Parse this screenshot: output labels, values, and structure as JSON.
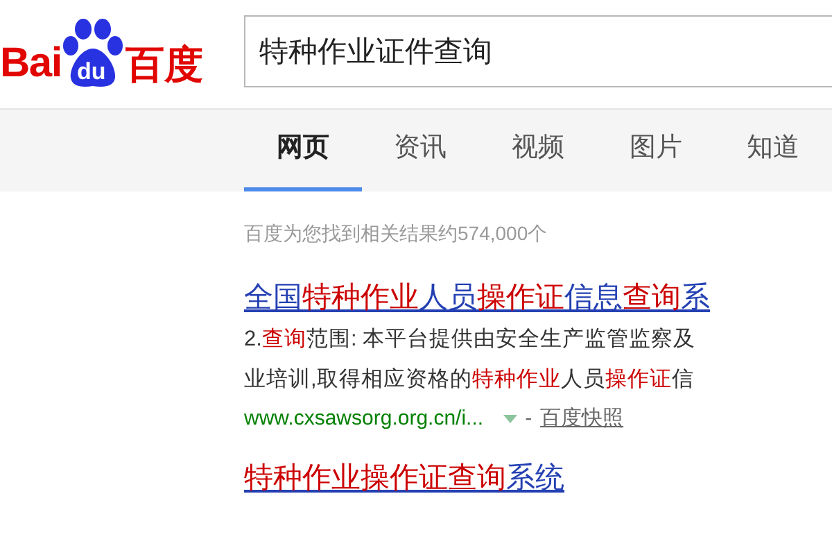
{
  "logo": {
    "parts": [
      "Bai",
      "du",
      "百度"
    ]
  },
  "search": {
    "value": "特种作业证件查询"
  },
  "tabs": [
    {
      "label": "网页",
      "selected": true
    },
    {
      "label": "资讯",
      "selected": false
    },
    {
      "label": "视频",
      "selected": false
    },
    {
      "label": "图片",
      "selected": false
    },
    {
      "label": "知道",
      "selected": false
    }
  ],
  "result_count": "百度为您找到相关结果约574,000个",
  "results": [
    {
      "title": [
        {
          "text": "全国",
          "highlight": false
        },
        {
          "text": "特种作业",
          "highlight": true
        },
        {
          "text": "人员",
          "highlight": false
        },
        {
          "text": "操作证",
          "highlight": true
        },
        {
          "text": "信息",
          "highlight": false
        },
        {
          "text": "查询",
          "highlight": true
        },
        {
          "text": "系",
          "highlight": false
        }
      ],
      "snippet": [
        [
          {
            "text": "2.",
            "highlight": false
          },
          {
            "text": "查询",
            "highlight": true
          },
          {
            "text": "范围: 本平台提供由安全生产监管监察及",
            "highlight": false
          }
        ],
        [
          {
            "text": "业培训,取得相应资格的",
            "highlight": false
          },
          {
            "text": "特种作业",
            "highlight": true
          },
          {
            "text": "人员",
            "highlight": false
          },
          {
            "text": "操作证",
            "highlight": true
          },
          {
            "text": "信",
            "highlight": false
          }
        ]
      ],
      "url": "www.cxsawsorg.org.cn/i...",
      "separator": "-",
      "cache": "百度快照"
    },
    {
      "title": [
        {
          "text": "特种作业操作证查询",
          "highlight": true
        },
        {
          "text": "系统",
          "highlight": false
        }
      ]
    }
  ]
}
